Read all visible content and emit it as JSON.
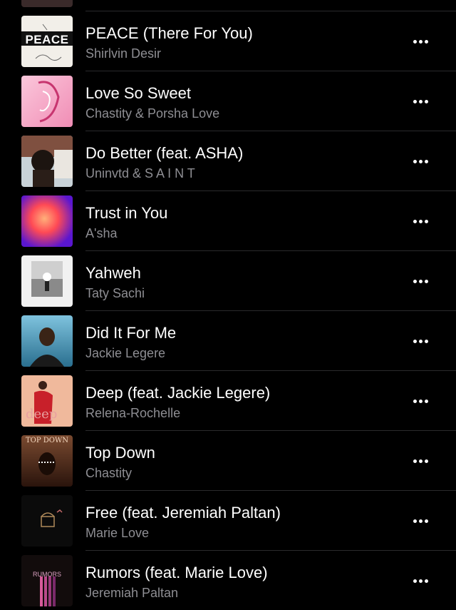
{
  "songs": [
    {
      "title": "",
      "artist": "",
      "art_colors": [
        "#1a1414",
        "#3a2a2a"
      ],
      "art_icon": "partial-album-art-icon"
    },
    {
      "title": "PEACE (There For You)",
      "artist": "Shirlvin Desir",
      "art_text": "PEACE",
      "art_colors": [
        "#f4f1ec",
        "#d9d3c9"
      ],
      "art_icon": "peace-album-art-icon"
    },
    {
      "title": "Love So Sweet",
      "artist": "Chastity & Porsha Love",
      "art_colors": [
        "#f7b6cf",
        "#e96a9e"
      ],
      "art_icon": "love-so-sweet-album-art-icon"
    },
    {
      "title": "Do Better (feat. ASHA)",
      "artist": "Uninvtd & S A I N T",
      "art_colors": [
        "#2b3b47",
        "#9c7c6a"
      ],
      "art_icon": "do-better-album-art-icon"
    },
    {
      "title": "Trust in You",
      "artist": "A'sha",
      "art_colors": [
        "#ff5a55",
        "#6a1fd8"
      ],
      "art_icon": "trust-in-you-album-art-icon"
    },
    {
      "title": "Yahweh",
      "artist": "Taty Sachi",
      "art_colors": [
        "#f2f2f2",
        "#6b6b6b"
      ],
      "art_icon": "yahweh-album-art-icon"
    },
    {
      "title": "Did It For Me",
      "artist": "Jackie Legere",
      "art_colors": [
        "#6ab1cf",
        "#1b4f6a"
      ],
      "art_icon": "did-it-for-me-album-art-icon"
    },
    {
      "title": "Deep (feat. Jackie Legere)",
      "artist": "Relena-Rochelle",
      "art_text": "deep",
      "art_colors": [
        "#e8a88a",
        "#c2202a"
      ],
      "art_icon": "deep-album-art-icon"
    },
    {
      "title": "Top Down",
      "artist": "Chastity",
      "art_text": "TOP DOWN",
      "art_colors": [
        "#6a3a24",
        "#2a140c"
      ],
      "art_icon": "top-down-album-art-icon"
    },
    {
      "title": "Free (feat. Jeremiah Paltan)",
      "artist": "Marie Love",
      "art_colors": [
        "#0a0a0a",
        "#7a5a3a"
      ],
      "art_icon": "free-album-art-icon"
    },
    {
      "title": "Rumors (feat. Marie Love)",
      "artist": "Jeremiah Paltan",
      "art_text": "RUMORS",
      "art_colors": [
        "#1a1212",
        "#c04a8a"
      ],
      "art_icon": "rumors-album-art-icon"
    }
  ],
  "more_icon": "ellipsis-icon"
}
